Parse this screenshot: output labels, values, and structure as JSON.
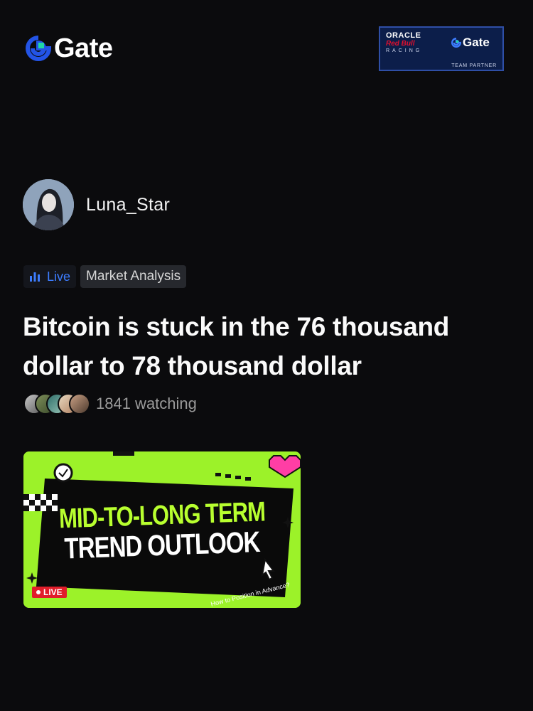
{
  "brand": {
    "name": "Gate",
    "color": "#2354e6",
    "accent": "#20d9a5"
  },
  "partner_badge": {
    "oracle": "ORACLE",
    "redbull": "Red Bull",
    "racing": "RACING",
    "gate": "Gate",
    "team_partner": "TEAM PARTNER"
  },
  "author": {
    "name": "Luna_Star",
    "avatar_icon": "avatar"
  },
  "tags": {
    "live": "Live",
    "topic": "Market Analysis"
  },
  "post": {
    "title": "Bitcoin is stuck in the 76 thousand dollar to 78 thousand dollar",
    "watching": "1841 watching"
  },
  "thumbnail": {
    "line1": "MID-TO-LONG TERM",
    "line2": "TREND OUTLOOK",
    "subtitle": "How to Position in Advance?",
    "live_badge": "LIVE",
    "background_color": "#9cf229"
  },
  "colors": {
    "background": "#0b0b0d",
    "live_blue": "#3d7dff",
    "muted": "#9a9a9a"
  }
}
